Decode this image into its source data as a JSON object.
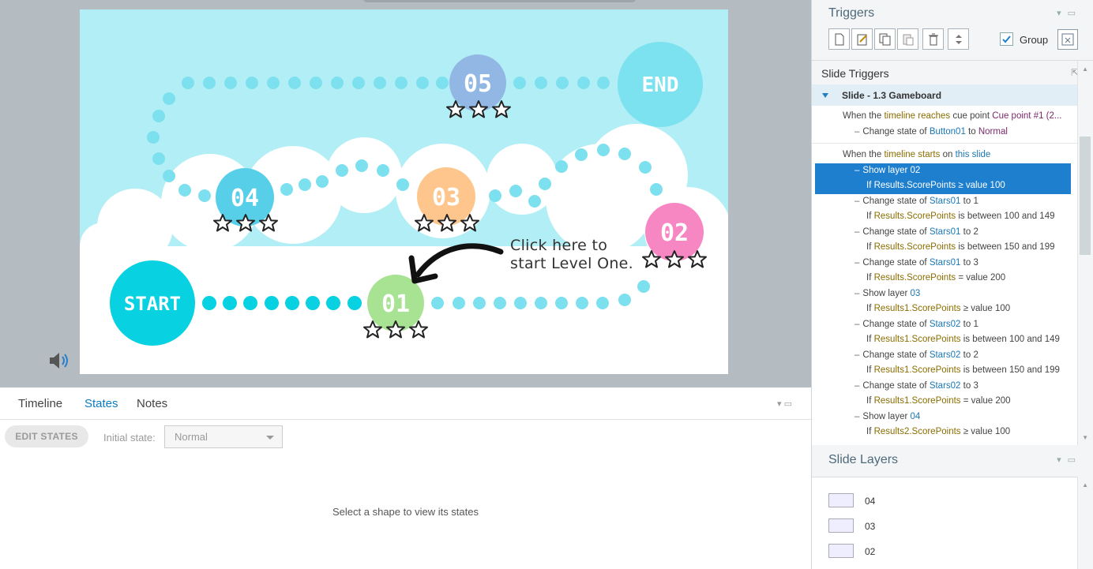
{
  "slide": {
    "nodes": {
      "start": "START",
      "end": "END",
      "level01": "01",
      "level02": "02",
      "level03": "03",
      "level04": "04",
      "level05": "05"
    },
    "callout_line1": "Click here to",
    "callout_line2": "start Level One.",
    "colors": {
      "sky": "#b2eef5",
      "start": "#08d1e2",
      "end": "#7ce2ef",
      "level01": "#a8e293",
      "level02": "#f687c3",
      "level03": "#fec68c",
      "level04": "#57cfe9",
      "level05": "#93b7e4",
      "path_dot": "#7de0ee"
    }
  },
  "bottom_panel": {
    "tabs": [
      "Timeline",
      "States",
      "Notes"
    ],
    "active_tab": "States",
    "edit_states_label": "EDIT STATES",
    "initial_state_label": "Initial state:",
    "initial_state_value": "Normal",
    "empty_message": "Select a shape to view its states"
  },
  "triggers_panel": {
    "title": "Triggers",
    "group_label": "Group",
    "group_checked": true
  },
  "slide_triggers": {
    "title": "Slide Triggers",
    "slide_row": "Slide - 1.3 Gameboard",
    "cue_trigger": {
      "prefix": "When the",
      "event": "timeline reaches",
      "mid": "cue point",
      "target": "Cue point #1 (2...",
      "action_prefix": "Change state of",
      "object": "Button01",
      "to": "to",
      "state": "Normal"
    },
    "start_trigger": {
      "prefix": "When the",
      "event": "timeline starts",
      "on": "on",
      "target": "this slide"
    },
    "actions": [
      {
        "action": "Show layer",
        "object": "02",
        "cond_if": "If",
        "cond_var": "Results.ScorePoints",
        "cond_op": "≥",
        "cond_val": "value 100",
        "selected": true
      },
      {
        "action": "Change state of",
        "object": "Stars01",
        "to": "to 1",
        "cond_if": "If",
        "cond_var": "Results.ScorePoints",
        "cond_op": "is between",
        "cond_val": "100 and 149"
      },
      {
        "action": "Change state of",
        "object": "Stars01",
        "to": "to 2",
        "cond_if": "If",
        "cond_var": "Results.ScorePoints",
        "cond_op": "is between",
        "cond_val": "150 and 199"
      },
      {
        "action": "Change state of",
        "object": "Stars01",
        "to": "to 3",
        "cond_if": "If",
        "cond_var": "Results.ScorePoints",
        "cond_op": "=",
        "cond_val": "value 200"
      },
      {
        "action": "Show layer",
        "object": "03",
        "cond_if": "If",
        "cond_var": "Results1.ScorePoints",
        "cond_op": "≥",
        "cond_val": "value 100"
      },
      {
        "action": "Change state of",
        "object": "Stars02",
        "to": "to 1",
        "cond_if": "If",
        "cond_var": "Results1.ScorePoints",
        "cond_op": "is between",
        "cond_val": "100 and 149"
      },
      {
        "action": "Change state of",
        "object": "Stars02",
        "to": "to 2",
        "cond_if": "If",
        "cond_var": "Results1.ScorePoints",
        "cond_op": "is between",
        "cond_val": "150 and 199"
      },
      {
        "action": "Change state of",
        "object": "Stars02",
        "to": "to 3",
        "cond_if": "If",
        "cond_var": "Results1.ScorePoints",
        "cond_op": "=",
        "cond_val": "value 200"
      },
      {
        "action": "Show layer",
        "object": "04",
        "cond_if": "If",
        "cond_var": "Results2.ScorePoints",
        "cond_op": "≥",
        "cond_val": "value 100"
      }
    ]
  },
  "slide_layers": {
    "title": "Slide Layers",
    "layers": [
      "04",
      "03",
      "02"
    ]
  }
}
